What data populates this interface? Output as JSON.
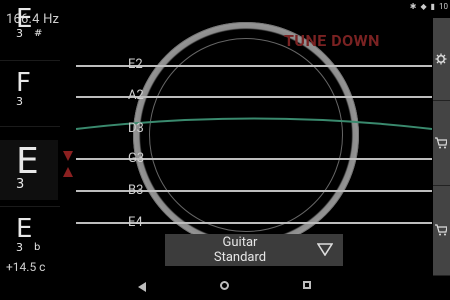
{
  "status_bar": {
    "clock": "10"
  },
  "readout": {
    "frequency": "166.4 Hz",
    "cents": "+14.5 c"
  },
  "notes": [
    {
      "letter": "E",
      "octave": "3",
      "accidental": "#",
      "state": "partial"
    },
    {
      "letter": "F",
      "octave": "3",
      "accidental": "",
      "state": "normal"
    },
    {
      "letter": "E",
      "octave": "3",
      "accidental": "",
      "state": "current"
    },
    {
      "letter": "E",
      "octave": "3",
      "accidental": "b",
      "state": "normal"
    }
  ],
  "indicator": {
    "message": "TUNE DOWN",
    "accent": "#8b2020"
  },
  "strings": [
    {
      "label": "E2"
    },
    {
      "label": "A2"
    },
    {
      "label": "D3",
      "active": true,
      "color": "#3a8a6e"
    },
    {
      "label": "G3"
    },
    {
      "label": "B3"
    },
    {
      "label": "E4"
    }
  ],
  "side_buttons": [
    {
      "icon": "gear-icon"
    },
    {
      "icon": "cart-icon"
    },
    {
      "icon": "cart-icon"
    }
  ],
  "tuning": {
    "instrument": "Guitar",
    "preset": "Standard",
    "icon": "triangle-down-icon"
  },
  "nav": {
    "back": "back-icon",
    "home": "home-icon",
    "recent": "recent-apps-icon"
  }
}
